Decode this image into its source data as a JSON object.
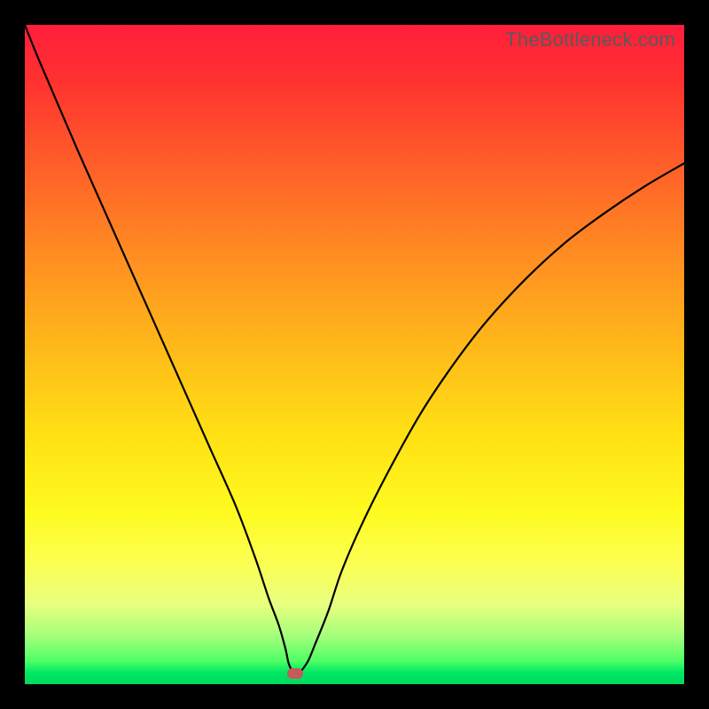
{
  "watermark": "TheBottleneck.com",
  "chart_data": {
    "type": "line",
    "title": "",
    "xlabel": "",
    "ylabel": "",
    "xlim": [
      0,
      100
    ],
    "ylim": [
      0,
      100
    ],
    "grid": false,
    "legend": false,
    "x": [
      0,
      2,
      5,
      8,
      12,
      16,
      20,
      24,
      28,
      32,
      35,
      37,
      38.5,
      39.5,
      40,
      40.5,
      41,
      41.5,
      42,
      43,
      44,
      46,
      48,
      51,
      55,
      60,
      65,
      70,
      76,
      82,
      88,
      94,
      100
    ],
    "values": [
      100,
      95,
      88,
      81,
      72,
      63,
      54,
      45,
      36,
      27,
      19,
      13,
      9,
      5.5,
      3.2,
      2.1,
      1.6,
      1.6,
      2.1,
      3.6,
      6,
      11,
      17,
      24,
      32,
      41,
      48.5,
      55,
      61.5,
      67,
      71.5,
      75.5,
      79
    ],
    "marker": {
      "x": 41,
      "y": 1.6
    },
    "background_gradient": {
      "top": "#ff1e3c",
      "mid": "#ffe014",
      "bottom": "#00d860"
    },
    "curve_style": {
      "color": "#000000",
      "width": 2
    },
    "marker_style": {
      "color": "#c55a5a",
      "shape": "rounded-rect"
    }
  }
}
